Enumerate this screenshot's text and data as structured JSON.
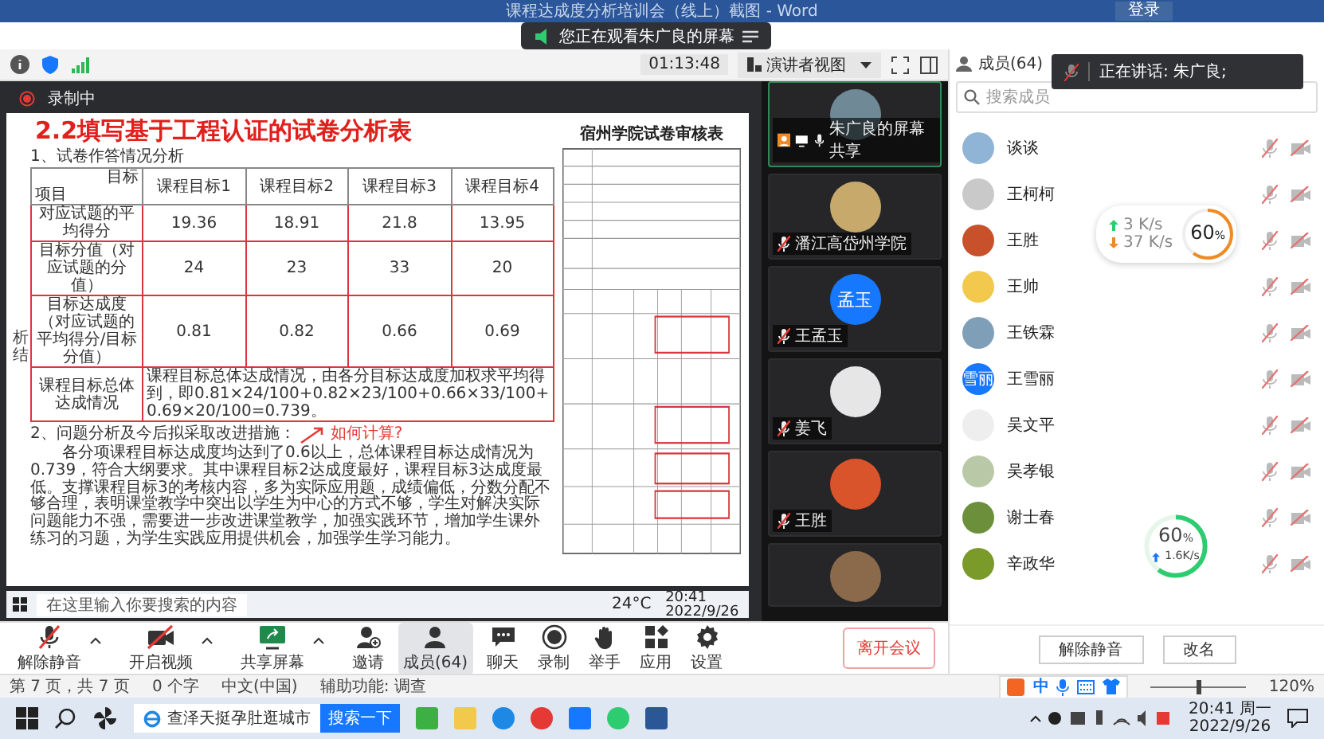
{
  "word_window": {
    "title": "课程达成度分析培训会（线上）截图 - Word",
    "login": "登录"
  },
  "notice": {
    "text": "您正在观看朱广良的屏幕"
  },
  "toolbar": {
    "timer": "01:13:48",
    "view": "演讲者视图"
  },
  "recording": {
    "label": "录制中"
  },
  "slide": {
    "title": "2.2填写基于工程认证的试卷分析表",
    "section": "1、试卷作答情况分析",
    "corner_top": "目标",
    "corner_bottom": "项目",
    "side_label": "析结",
    "columns": [
      "课程目标1",
      "课程目标2",
      "课程目标3",
      "课程目标4"
    ],
    "rows": [
      {
        "label": "对应试题的平均得分",
        "values": [
          "19.36",
          "18.91",
          "21.8",
          "13.95"
        ]
      },
      {
        "label": "目标分值（对应试题的分值）",
        "values": [
          "24",
          "23",
          "33",
          "20"
        ]
      },
      {
        "label": "目标达成度（对应试题的平均得分/目标分值）",
        "values": [
          "0.81",
          "0.82",
          "0.66",
          "0.69"
        ]
      }
    ],
    "summary_label": "课程目标总体达成情况",
    "summary": "课程目标总体达成情况，由各分目标达成度加权求平均得到，即0.81×24/100+0.82×23/100+0.66×33/100+0.69×20/100=0.739。",
    "section2": "2、问题分析及今后拟采取改进措施：",
    "paragraph": "各分项课程目标达成度均达到了0.6以上，总体课程目标达成情况为0.739，符合大纲要求。其中课程目标2达成度最好，课程目标3达成度最低。支撑课程目标3的考核内容，多为实际应用题，成绩偏低，分数分配不够合理，表明课堂教学中突出以学生为中心的方式不够，学生对解决实际问题能力不强，需要进一步改进课堂教学，加强实践环节，增加学生课外练习的习题，为学生实践应用提供机会，加强学生学习能力。",
    "annotation": "如何计算?",
    "document_title": "宿州学院试卷审核表"
  },
  "shared_taskbar": {
    "search": "在这里输入你要搜索的内容",
    "weather": "24°C",
    "time": "20:41",
    "date": "2022/9/26"
  },
  "videos": [
    {
      "name": "朱广良的屏幕共享",
      "sharing": true,
      "muted": false
    },
    {
      "name": "潘江高岱州学院",
      "sharing": false,
      "muted": true
    },
    {
      "name": "王孟玉",
      "avatar_text": "孟玉",
      "sharing": false,
      "muted": true
    },
    {
      "name": "姜飞",
      "sharing": false,
      "muted": true
    },
    {
      "name": "王胜",
      "sharing": false,
      "muted": true
    }
  ],
  "members_panel": {
    "title": "成员(64)",
    "search_placeholder": "搜索成员",
    "speaking": "正在讲话: 朱广良;",
    "members": [
      {
        "name": "谈谈",
        "muted": true
      },
      {
        "name": "王柯柯",
        "muted": true
      },
      {
        "name": "王胜",
        "muted": true
      },
      {
        "name": "王帅",
        "muted": true
      },
      {
        "name": "王铁霖",
        "muted": true
      },
      {
        "name": "王雪丽",
        "avatar_text": "雪丽",
        "muted": true
      },
      {
        "name": "吴文平",
        "muted": true
      },
      {
        "name": "吴孝银",
        "muted": true
      },
      {
        "name": "谢士春",
        "muted": true
      },
      {
        "name": "辛政华",
        "muted": true
      }
    ],
    "buttons": [
      "解除静音",
      "改名"
    ]
  },
  "network": {
    "upload": "3 K/s",
    "download": "37 K/s",
    "percent": "60",
    "unit": "%",
    "level": 0.6
  },
  "network2": {
    "percent": "60",
    "unit": "%",
    "upload": "1.6K/s",
    "level": 0.6
  },
  "controls": [
    {
      "label": "解除静音",
      "kind": "mic-off",
      "caret": true,
      "selected": false
    },
    {
      "label": "开启视频",
      "kind": "video-off",
      "caret": true,
      "selected": false
    },
    {
      "label": "共享屏幕",
      "kind": "share",
      "caret": true,
      "selected": false
    },
    {
      "label": "邀请",
      "kind": "invite",
      "caret": false,
      "selected": false
    },
    {
      "label": "成员(64)",
      "kind": "members",
      "caret": false,
      "selected": true
    },
    {
      "label": "聊天",
      "kind": "chat",
      "caret": false,
      "selected": false
    },
    {
      "label": "录制",
      "kind": "record",
      "caret": false,
      "selected": false
    },
    {
      "label": "举手",
      "kind": "hand",
      "caret": false,
      "selected": false
    },
    {
      "label": "应用",
      "kind": "apps",
      "caret": false,
      "selected": false
    },
    {
      "label": "设置",
      "kind": "settings",
      "caret": false,
      "selected": false
    }
  ],
  "leave": "离开会议",
  "status_bar": {
    "page": "第 7 页，共 7 页",
    "words": "0 个字",
    "language": "中文(中国)",
    "accessibility": "辅助功能: 调查",
    "ime": "中",
    "zoom": "120%",
    "zoom_level": {
      "level": 0.5
    }
  },
  "taskbar": {
    "search": "查泽天挺孕肚逛城市",
    "search_button": "搜索一下",
    "time": "20:41 周一",
    "date": "2022/9/26"
  }
}
